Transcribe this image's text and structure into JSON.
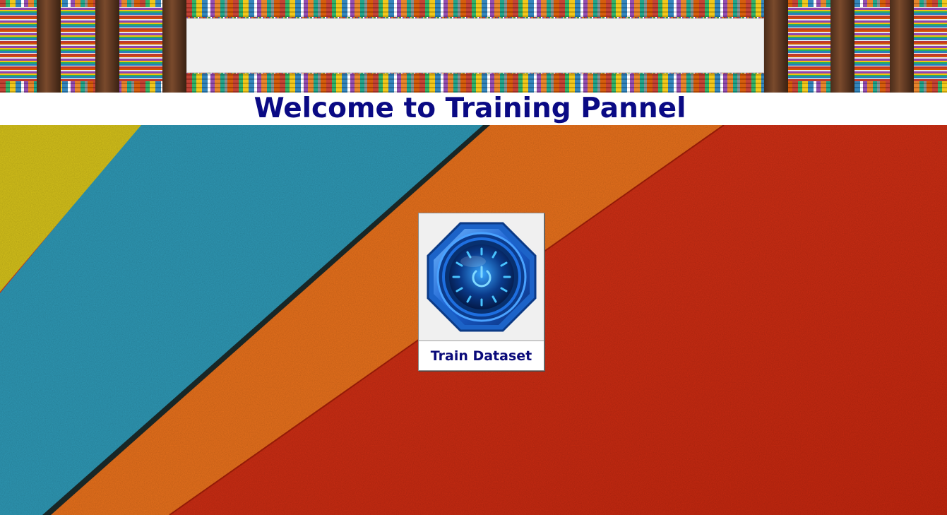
{
  "header": {
    "title": "Welcome to Training Pannel"
  },
  "train_button": {
    "label": "Train Dataset",
    "icon": "power-button-icon"
  },
  "colors": {
    "title_text": "#0a0a84",
    "button_label": "#0a0a7a",
    "panel_gray": "#f0f0f0",
    "stripe_yellow": "#d6c21a",
    "stripe_teal": "#2e98b5",
    "stripe_orange": "#e8711c",
    "stripe_red": "#cc2a10",
    "icon_blue": "#1f6fe0"
  }
}
